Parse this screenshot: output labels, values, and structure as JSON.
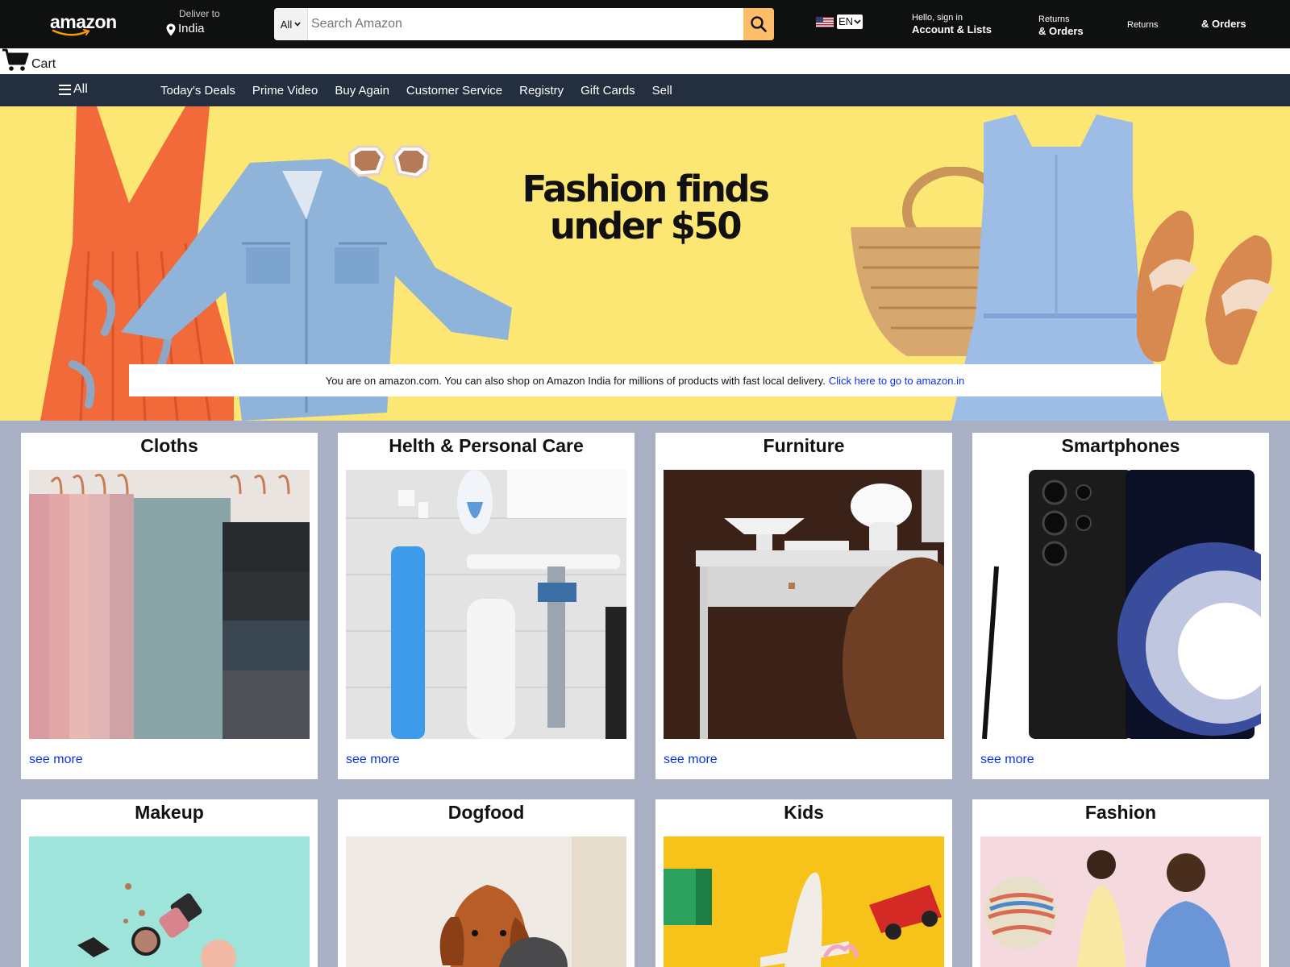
{
  "header": {
    "logo_text": "amazon",
    "deliver_to_label": "Deliver to",
    "deliver_to_location": "India",
    "search": {
      "category": "All",
      "placeholder": "Search Amazon"
    },
    "language": "EN",
    "account_greeting": "Hello, sign in",
    "account_label": "Account & Lists",
    "returns_small": "Returns",
    "returns_bold": "& Orders",
    "returns_link": "Returns",
    "orders_link": "& Orders",
    "cart_label": "Cart"
  },
  "nav": {
    "all_label": "All",
    "items": [
      "Today's Deals",
      "Prime Video",
      "Buy Again",
      "Customer Service",
      "Registry",
      "Gift Cards",
      "Sell"
    ]
  },
  "hero": {
    "title_line1": "Fashion finds",
    "title_line2": "under $50",
    "notice_text": "You are on amazon.com. You can also shop on Amazon India for millions of products with fast local delivery.",
    "notice_link": "Click here to go to amazon.in"
  },
  "cards": [
    {
      "title": "Cloths",
      "link": "see more"
    },
    {
      "title": "Helth & Personal Care",
      "link": "see more"
    },
    {
      "title": "Furniture",
      "link": "see more"
    },
    {
      "title": "Smartphones",
      "link": "see more"
    },
    {
      "title": "Makeup",
      "link": ""
    },
    {
      "title": "Dogfood",
      "link": ""
    },
    {
      "title": "Kids",
      "link": ""
    },
    {
      "title": "Fashion",
      "link": ""
    }
  ],
  "colors": {
    "header_bg": "#0f1111",
    "nav_bg": "#232f3e",
    "search_button": "#febd69",
    "hero_bg": "#fce774",
    "page_bg": "#aab0c4",
    "link": "#0a32e6"
  }
}
